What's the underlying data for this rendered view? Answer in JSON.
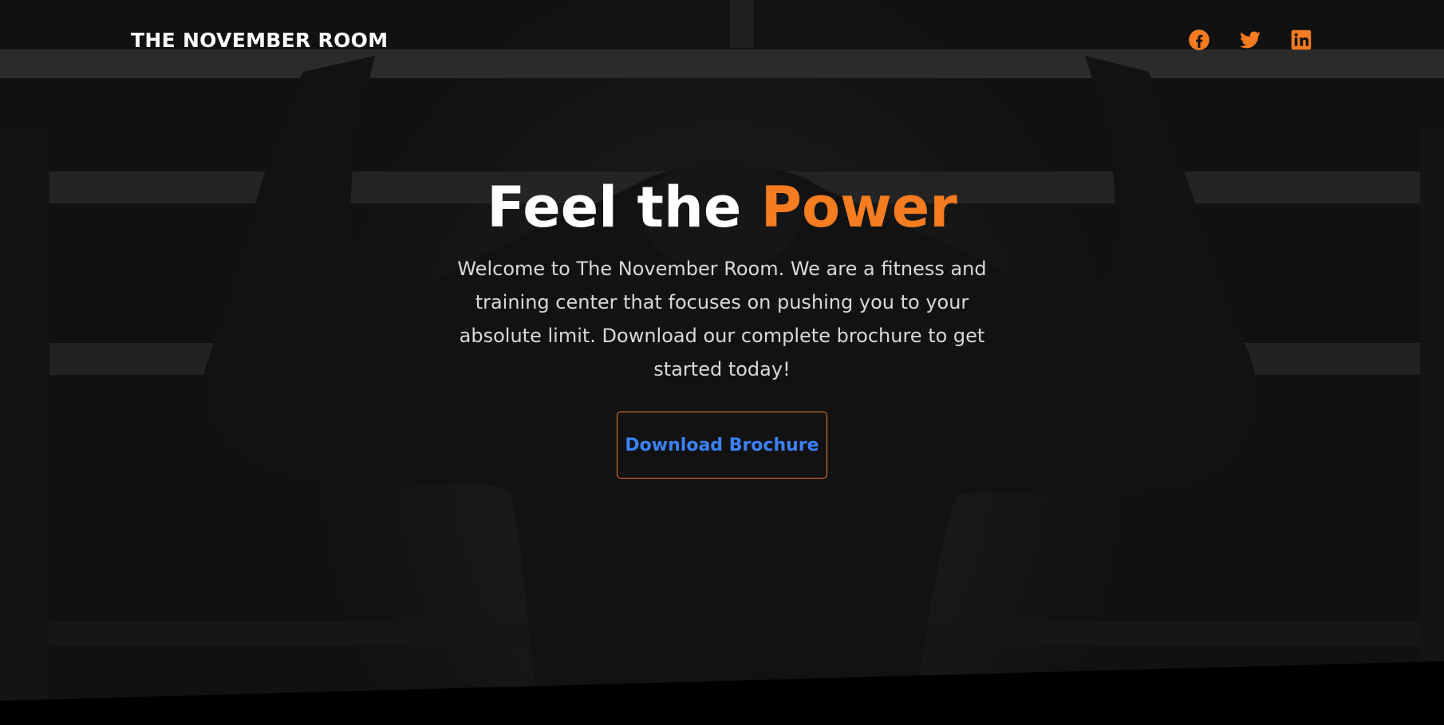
{
  "brand": "THE NOVEMBER ROOM",
  "social": [
    {
      "icon": "facebook-icon",
      "color": "#f57c20"
    },
    {
      "icon": "twitter-icon",
      "color": "#f57c20"
    },
    {
      "icon": "linkedin-icon",
      "color": "#f57c20"
    }
  ],
  "hero": {
    "headline_main": "Feel the ",
    "headline_accent": "Power",
    "lead": "Welcome to The November Room. We are a fitness and training center that focuses on pushing you to your absolute limit. Download our complete brochure to get started today!",
    "cta_label": "Download Brochure"
  },
  "colors": {
    "accent": "#f57c20",
    "link": "#3b82f6",
    "background": "#1a1a1a"
  }
}
